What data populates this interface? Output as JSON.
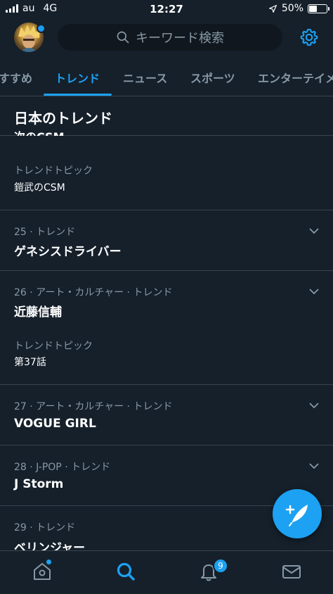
{
  "status": {
    "carrier": "au",
    "network": "4G",
    "time": "12:27",
    "battery": "50%",
    "battery_level": 0.5
  },
  "search": {
    "placeholder": "キーワード検索"
  },
  "tabs": [
    {
      "label": "すすめ"
    },
    {
      "label": "トレンド",
      "active": true
    },
    {
      "label": "ニュース"
    },
    {
      "label": "スポーツ"
    },
    {
      "label": "エンターテイメ"
    }
  ],
  "section": {
    "title": "日本のトレンド",
    "peek_text": "次のCSM"
  },
  "trends": [
    {
      "sub_label": "トレンドトピック",
      "sub_value": "鎧武のCSM"
    },
    {
      "meta": "25 · トレンド",
      "name": "ゲネシスドライバー"
    },
    {
      "meta": "26 · アート・カルチャー · トレンド",
      "name": "近藤信輔",
      "sub_label": "トレンドトピック",
      "sub_value": "第37話"
    },
    {
      "meta": "27 · アート・カルチャー · トレンド",
      "name": "VOGUE GIRL"
    },
    {
      "meta": "28 · J-POP · トレンド",
      "name": "J Storm"
    },
    {
      "meta": "29 · トレンド",
      "name": "ベリンジャー"
    }
  ],
  "nav": {
    "notification_count": "9"
  },
  "colors": {
    "background": "#15202b",
    "accent": "#1da1f2",
    "divider": "#38444d",
    "muted": "#8899a6"
  }
}
